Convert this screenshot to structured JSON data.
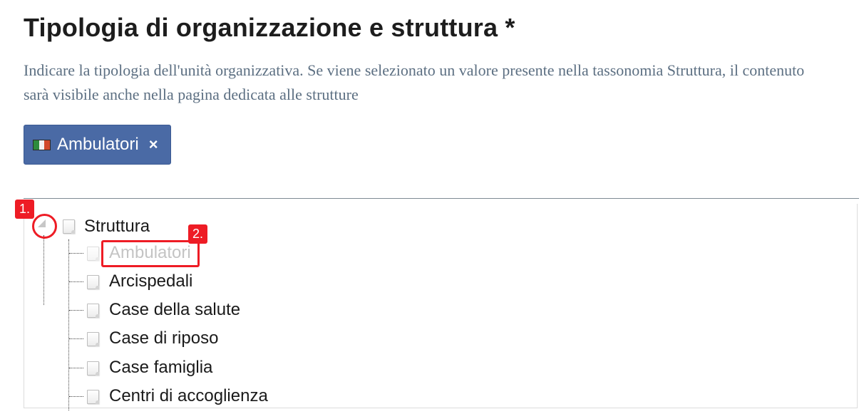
{
  "field": {
    "title": "Tipologia di organizzazione e struttura *",
    "description": "Indicare la tipologia dell'unità organizzativa. Se viene selezionato un valore presente nella tassonomia Struttura, il contenuto sarà visibile anche nella pagina dedicata alle strutture"
  },
  "selected_chip": {
    "label": "Ambulatori",
    "remove_symbol": "×",
    "icon": "italy-flag-icon"
  },
  "tree": {
    "root": {
      "label": "Struttura",
      "expander_icon": "collapse-triangle-icon"
    },
    "children": [
      {
        "label": "Ambulatori",
        "disabled": true
      },
      {
        "label": "Arcispedali",
        "disabled": false
      },
      {
        "label": "Case della salute",
        "disabled": false
      },
      {
        "label": "Case di riposo",
        "disabled": false
      },
      {
        "label": "Case famiglia",
        "disabled": false
      },
      {
        "label": "Centri di accoglienza",
        "disabled": false
      }
    ]
  },
  "annotations": {
    "badge_1": "1.",
    "badge_2": "2.",
    "color": "#ee1c25"
  },
  "colors": {
    "chip_background": "#4a6aa5",
    "description_text": "#5c6f82",
    "disabled_text": "#c4c4c4"
  }
}
